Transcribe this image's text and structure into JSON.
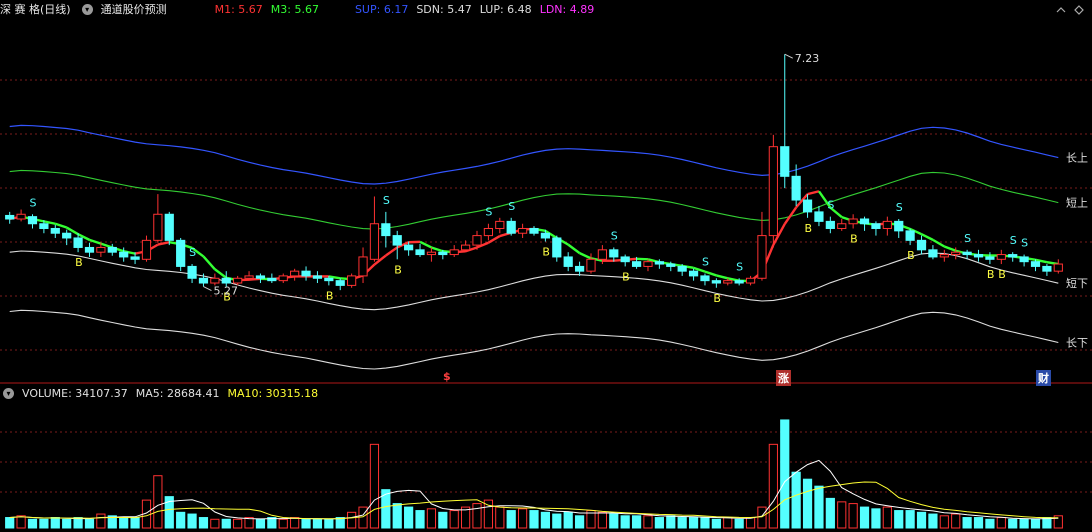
{
  "header": {
    "stock_name": "深 赛 格(日线)",
    "indicator_name": "通道股价预测",
    "m1": "M1: 5.67",
    "m3": "M3: 5.67",
    "sup": "SUP: 6.17",
    "sdn": "SDN: 5.47",
    "lup": "LUP: 6.48",
    "ldn": "LDN: 4.89"
  },
  "colors": {
    "m1": "#ff3333",
    "m3": "#33ff33",
    "sup": "#3355ff",
    "sdn": "#dddddd",
    "lup": "#dddddd",
    "ldn": "#ff33ff",
    "up": "#ff3232",
    "down": "#54ffff",
    "ma5": "#ffffff",
    "ma10": "#ffff33"
  },
  "annotations": {
    "high_price": "7.23",
    "low_price": "5.27",
    "long_upper": "长上",
    "short_upper": "短上",
    "short_lower": "短下",
    "long_lower": "长下",
    "sell_mark": "S",
    "buy_mark": "B",
    "event_mark_1": "$",
    "event_mark_2": "涨",
    "event_mark_3": "财"
  },
  "volume": {
    "label": "VOLUME: 34107.37",
    "ma5": "MA5: 28684.41",
    "ma10": "MA10: 30315.18"
  },
  "chart_data": {
    "type": "candlestick",
    "candles": [
      [
        5.87,
        5.84,
        5.9,
        5.8
      ],
      [
        5.84,
        5.88,
        5.92,
        5.82
      ],
      [
        5.86,
        5.8,
        5.88,
        5.76
      ],
      [
        5.8,
        5.76,
        5.83,
        5.72
      ],
      [
        5.76,
        5.72,
        5.79,
        5.68
      ],
      [
        5.72,
        5.68,
        5.75,
        5.62
      ],
      [
        5.68,
        5.6,
        5.72,
        5.56
      ],
      [
        5.6,
        5.56,
        5.64,
        5.52
      ],
      [
        5.56,
        5.6,
        5.64,
        5.52
      ],
      [
        5.6,
        5.56,
        5.63,
        5.53
      ],
      [
        5.56,
        5.52,
        5.6,
        5.48
      ],
      [
        5.52,
        5.5,
        5.56,
        5.46
      ],
      [
        5.5,
        5.66,
        5.7,
        5.48
      ],
      [
        5.66,
        5.88,
        6.05,
        5.64
      ],
      [
        5.88,
        5.66,
        5.9,
        5.62
      ],
      [
        5.66,
        5.44,
        5.68,
        5.4
      ],
      [
        5.44,
        5.34,
        5.46,
        5.3
      ],
      [
        5.34,
        5.3,
        5.38,
        5.27
      ],
      [
        5.3,
        5.34,
        5.38,
        5.28
      ],
      [
        5.34,
        5.3,
        5.4,
        5.27
      ],
      [
        5.3,
        5.34,
        5.36,
        5.28
      ],
      [
        5.34,
        5.36,
        5.4,
        5.32
      ],
      [
        5.36,
        5.34,
        5.38,
        5.3
      ],
      [
        5.34,
        5.32,
        5.38,
        5.3
      ],
      [
        5.32,
        5.36,
        5.38,
        5.3
      ],
      [
        5.36,
        5.4,
        5.42,
        5.32
      ],
      [
        5.4,
        5.36,
        5.44,
        5.32
      ],
      [
        5.36,
        5.34,
        5.4,
        5.3
      ],
      [
        5.34,
        5.32,
        5.36,
        5.28
      ],
      [
        5.32,
        5.28,
        5.34,
        5.24
      ],
      [
        5.28,
        5.36,
        5.38,
        5.26
      ],
      [
        5.36,
        5.52,
        5.6,
        5.3
      ],
      [
        5.5,
        5.8,
        6.03,
        5.48
      ],
      [
        5.8,
        5.7,
        5.9,
        5.6
      ],
      [
        5.7,
        5.62,
        5.74,
        5.5
      ],
      [
        5.62,
        5.58,
        5.65,
        5.53
      ],
      [
        5.58,
        5.54,
        5.63,
        5.52
      ],
      [
        5.54,
        5.56,
        5.6,
        5.48
      ],
      [
        5.56,
        5.54,
        5.58,
        5.5
      ],
      [
        5.54,
        5.58,
        5.62,
        5.52
      ],
      [
        5.58,
        5.62,
        5.66,
        5.56
      ],
      [
        5.62,
        5.7,
        5.74,
        5.58
      ],
      [
        5.7,
        5.76,
        5.8,
        5.66
      ],
      [
        5.76,
        5.82,
        5.85,
        5.72
      ],
      [
        5.82,
        5.72,
        5.85,
        5.7
      ],
      [
        5.72,
        5.76,
        5.8,
        5.68
      ],
      [
        5.76,
        5.72,
        5.78,
        5.7
      ],
      [
        5.72,
        5.68,
        5.75,
        5.65
      ],
      [
        5.68,
        5.52,
        5.7,
        5.48
      ],
      [
        5.52,
        5.44,
        5.56,
        5.4
      ],
      [
        5.44,
        5.4,
        5.48,
        5.36
      ],
      [
        5.4,
        5.5,
        5.55,
        5.38
      ],
      [
        5.5,
        5.58,
        5.62,
        5.46
      ],
      [
        5.58,
        5.52,
        5.6,
        5.48
      ],
      [
        5.52,
        5.48,
        5.54,
        5.44
      ],
      [
        5.48,
        5.44,
        5.52,
        5.42
      ],
      [
        5.44,
        5.48,
        5.5,
        5.4
      ],
      [
        5.48,
        5.46,
        5.5,
        5.42
      ],
      [
        5.46,
        5.44,
        5.48,
        5.4
      ],
      [
        5.44,
        5.4,
        5.46,
        5.36
      ],
      [
        5.4,
        5.36,
        5.42,
        5.32
      ],
      [
        5.36,
        5.32,
        5.38,
        5.28
      ],
      [
        5.32,
        5.3,
        5.34,
        5.26
      ],
      [
        5.3,
        5.32,
        5.34,
        5.28
      ],
      [
        5.32,
        5.3,
        5.34,
        5.28
      ],
      [
        5.3,
        5.34,
        5.36,
        5.28
      ],
      [
        5.34,
        5.7,
        5.9,
        5.32
      ],
      [
        5.7,
        6.45,
        6.55,
        5.6
      ],
      [
        6.45,
        6.2,
        7.23,
        6.1
      ],
      [
        6.2,
        6.0,
        6.3,
        5.95
      ],
      [
        6.0,
        5.9,
        6.05,
        5.85
      ],
      [
        5.9,
        5.82,
        5.95,
        5.78
      ],
      [
        5.82,
        5.76,
        5.86,
        5.72
      ],
      [
        5.76,
        5.8,
        5.84,
        5.74
      ],
      [
        5.8,
        5.84,
        5.88,
        5.76
      ],
      [
        5.84,
        5.8,
        5.86,
        5.74
      ],
      [
        5.8,
        5.76,
        5.82,
        5.7
      ],
      [
        5.76,
        5.82,
        5.86,
        5.7
      ],
      [
        5.82,
        5.74,
        5.84,
        5.68
      ],
      [
        5.74,
        5.66,
        5.76,
        5.62
      ],
      [
        5.66,
        5.58,
        5.7,
        5.54
      ],
      [
        5.58,
        5.52,
        5.62,
        5.5
      ],
      [
        5.52,
        5.54,
        5.58,
        5.48
      ],
      [
        5.54,
        5.56,
        5.6,
        5.5
      ],
      [
        5.56,
        5.54,
        5.58,
        5.5
      ],
      [
        5.54,
        5.52,
        5.58,
        5.48
      ],
      [
        5.52,
        5.5,
        5.56,
        5.46
      ],
      [
        5.5,
        5.54,
        5.58,
        5.46
      ],
      [
        5.54,
        5.52,
        5.56,
        5.48
      ],
      [
        5.52,
        5.48,
        5.54,
        5.44
      ],
      [
        5.48,
        5.44,
        5.5,
        5.4
      ],
      [
        5.44,
        5.4,
        5.46,
        5.36
      ],
      [
        5.4,
        5.46,
        5.5,
        5.38
      ]
    ],
    "volume": [
      6,
      7,
      5,
      5,
      6,
      5,
      6,
      5,
      8,
      7,
      6,
      6,
      16,
      30,
      18,
      9,
      8,
      6,
      5,
      5,
      5,
      6,
      5,
      6,
      5,
      6,
      5,
      5,
      5,
      6,
      9,
      12,
      48,
      22,
      14,
      12,
      10,
      11,
      9,
      10,
      12,
      14,
      16,
      12,
      10,
      11,
      10,
      9,
      8,
      9,
      7,
      10,
      9,
      8,
      7,
      7,
      7,
      6,
      7,
      6,
      6,
      6,
      5,
      6,
      5,
      6,
      12,
      48,
      62,
      32,
      28,
      24,
      17,
      15,
      14,
      12,
      11,
      12,
      10,
      10,
      9,
      8,
      7,
      8,
      6,
      6,
      5,
      6,
      5,
      5,
      5,
      6,
      7
    ],
    "signals": {
      "S": [
        2,
        16,
        33,
        42,
        44,
        53,
        61,
        64,
        72,
        78,
        84,
        88,
        89
      ],
      "B": [
        6,
        19,
        28,
        34,
        47,
        54,
        62,
        70,
        74,
        79,
        86,
        87
      ]
    }
  }
}
